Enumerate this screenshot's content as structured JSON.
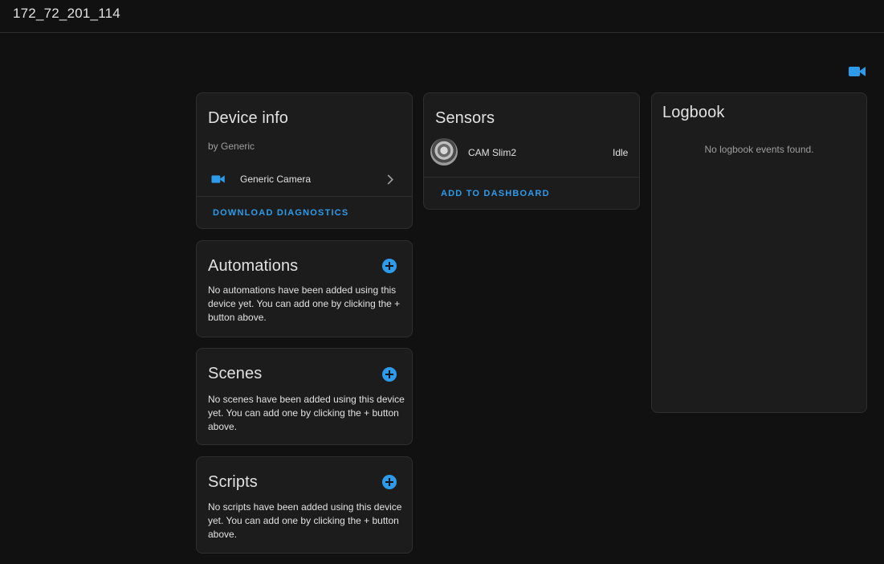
{
  "page": {
    "title": "172_72_201_114"
  },
  "header": {
    "camera_icon": "video-camera-icon"
  },
  "device_info": {
    "title": "Device info",
    "manufacturer": "by Generic",
    "entity_label": "Generic Camera",
    "download_label": "DOWNLOAD DIAGNOSTICS"
  },
  "automations": {
    "title": "Automations",
    "empty_text": "No automations have been added using this device yet. You can add one by clicking the + button above."
  },
  "scenes": {
    "title": "Scenes",
    "empty_text": "No scenes have been added using this device yet. You can add one by clicking the + button above."
  },
  "scripts": {
    "title": "Scripts",
    "empty_text": "No scripts have been added using this device yet. You can add one by clicking the + button above."
  },
  "sensors": {
    "title": "Sensors",
    "entity_name": "CAM Slim2",
    "entity_state": "Idle",
    "add_label": "ADD TO DASHBOARD"
  },
  "logbook": {
    "title": "Logbook",
    "empty_text": "No logbook events found."
  },
  "colors": {
    "accent": "#2d9bea",
    "background": "#111111",
    "card": "#1c1c1c"
  }
}
